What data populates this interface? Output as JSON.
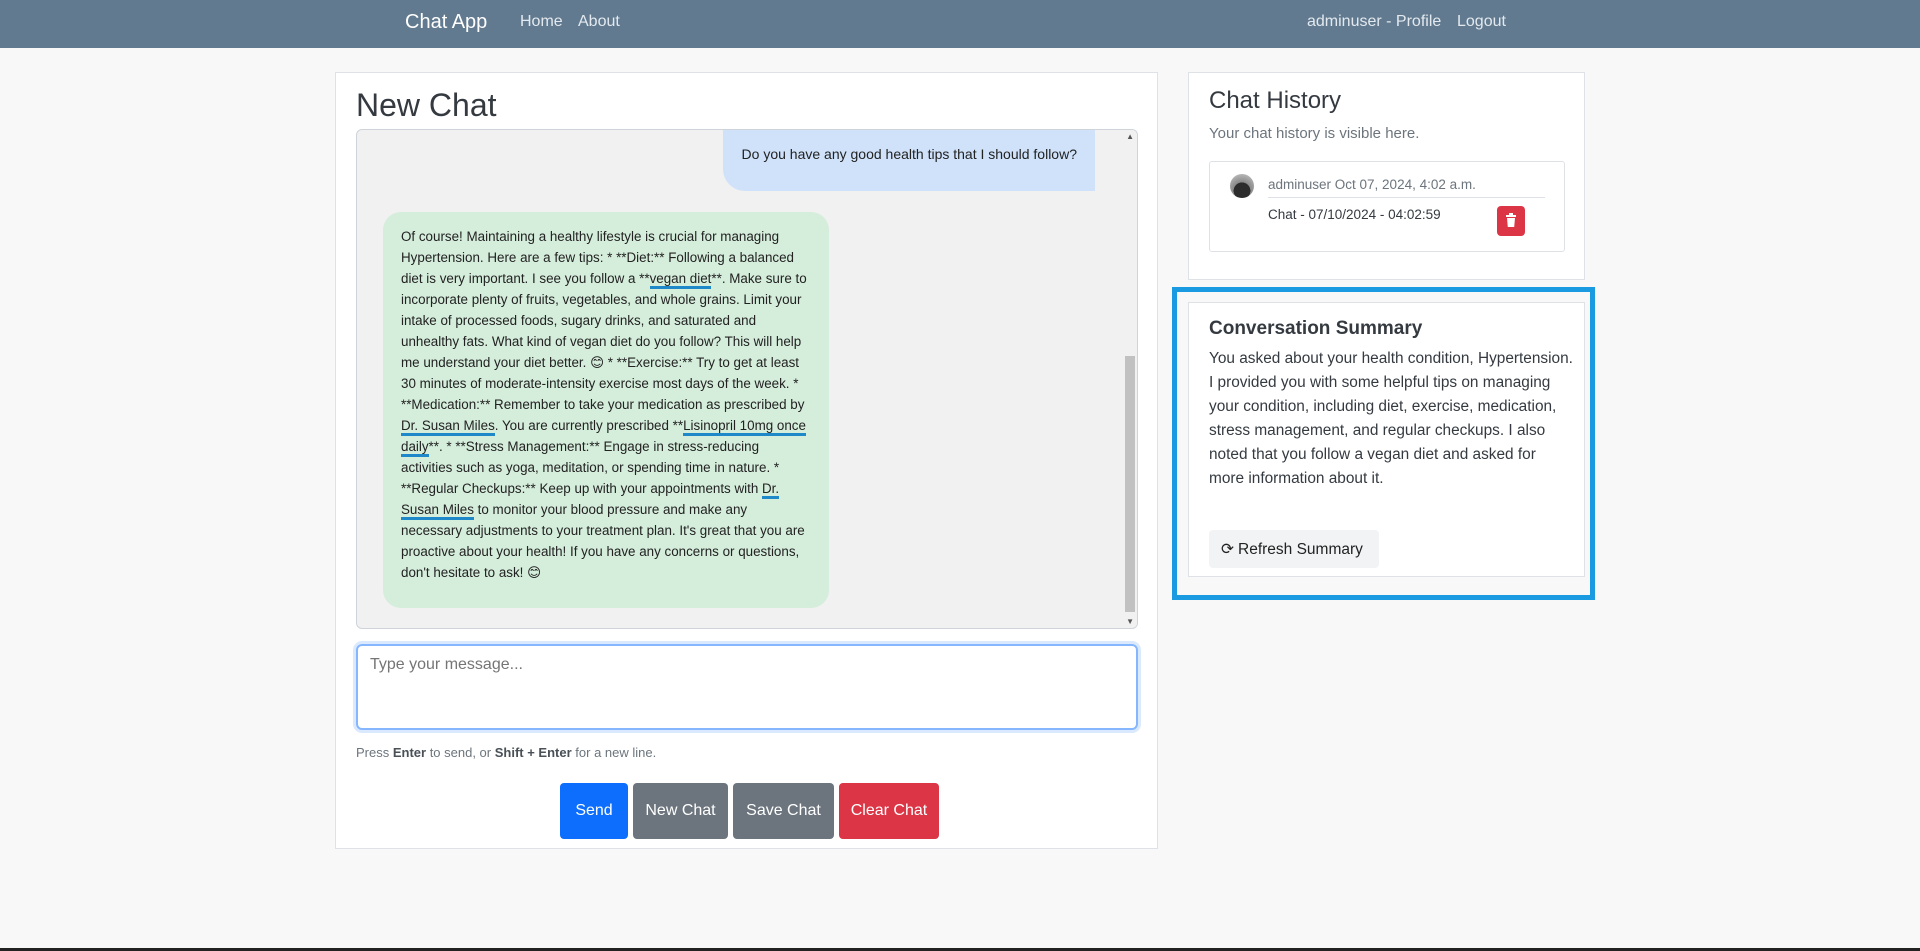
{
  "navbar": {
    "brand": "Chat App",
    "home": "Home",
    "about": "About",
    "profile": "adminuser - Profile",
    "logout": "Logout"
  },
  "chat": {
    "title": "New Chat",
    "user_message": "Do you have any good health tips that I should follow?",
    "bot_message": {
      "p1": "Of course! Maintaining a healthy lifestyle is crucial for managing Hypertension. Here are a few tips: * **Diet:** Following a balanced diet is very important. I see you follow a **",
      "highlight1": "vegan diet",
      "p2": "**. Make sure to incorporate plenty of fruits, vegetables, and whole grains. Limit your intake of processed foods, sugary drinks, and saturated and unhealthy fats. What kind of vegan diet do you follow? This will help me understand your diet better. 😊 * **Exercise:** Try to get at least 30 minutes of moderate-intensity exercise most days of the week. * **Medication:** Remember to take your medication as prescribed by ",
      "highlight2": "Dr. Susan Miles",
      "p3": ". You are currently prescribed **",
      "highlight3": "Lisinopril 10mg once daily",
      "p4": "**. * **Stress Management:** Engage in stress-reducing activities such as yoga, meditation, or spending time in nature. * **Regular Checkups:** Keep up with your appointments with ",
      "highlight4": "Dr. Susan Miles",
      "p5": " to monitor your blood pressure and make any necessary adjustments to your treatment plan. It's great that you are proactive about your health! If you have any concerns or questions, don't hesitate to ask! 😊"
    },
    "input_placeholder": "Type your message...",
    "hint": {
      "press": "Press ",
      "enter": "Enter",
      "to_send": " to send, or ",
      "shift_enter": "Shift + Enter",
      "new_line": " for a new line."
    },
    "buttons": {
      "send": "Send",
      "new_chat": "New Chat",
      "save_chat": "Save Chat",
      "clear_chat": "Clear Chat"
    }
  },
  "history": {
    "title": "Chat History",
    "subtitle": "Your chat history is visible here.",
    "items": [
      {
        "meta": "adminuser Oct 07, 2024, 4:02 a.m.",
        "title": "Chat - 07/10/2024 - 04:02:59"
      }
    ]
  },
  "summary": {
    "title": "Conversation Summary",
    "text": "You asked about your health condition, Hypertension. I provided you with some helpful tips on managing your condition, including diet, exercise, medication, stress management, and regular checkups. I also noted that you follow a vegan diet and asked for more information about it.",
    "refresh_label": "Refresh Summary"
  },
  "icons": {
    "refresh": "refresh-icon",
    "trash": "trash-icon",
    "avatar": "avatar"
  },
  "colors": {
    "navbar": "#617a8f",
    "send": "#0d6efd",
    "secondary": "#6c757d",
    "danger": "#dc3545",
    "highlight": "#1a9ae0",
    "user_bubble": "#cfe2fa",
    "bot_bubble": "#d5eddb"
  }
}
